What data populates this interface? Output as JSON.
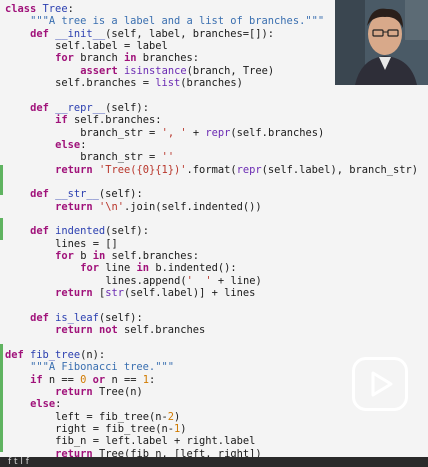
{
  "code_lines": [
    {
      "indent": 0,
      "tokens": [
        [
          "kw",
          "class "
        ],
        [
          "fn",
          "Tree"
        ],
        [
          "t",
          ":"
        ]
      ]
    },
    {
      "indent": 4,
      "tokens": [
        [
          "cm",
          "\"\"\"A tree is a label and a list of branches.\"\"\""
        ]
      ]
    },
    {
      "indent": 4,
      "tokens": [
        [
          "kw",
          "def "
        ],
        [
          "fn",
          "__init__"
        ],
        [
          "t",
          "(self, label, branches=[]):"
        ]
      ]
    },
    {
      "indent": 8,
      "tokens": [
        [
          "t",
          "self.label = label"
        ]
      ]
    },
    {
      "indent": 8,
      "tokens": [
        [
          "kw",
          "for "
        ],
        [
          "t",
          "branch "
        ],
        [
          "kw",
          "in "
        ],
        [
          "t",
          "branches:"
        ]
      ]
    },
    {
      "indent": 12,
      "tokens": [
        [
          "kw",
          "assert "
        ],
        [
          "bi",
          "isinstance"
        ],
        [
          "t",
          "(branch, Tree)"
        ]
      ]
    },
    {
      "indent": 8,
      "tokens": [
        [
          "t",
          "self.branches = "
        ],
        [
          "bi",
          "list"
        ],
        [
          "t",
          "(branches)"
        ]
      ]
    },
    {
      "indent": 0,
      "tokens": []
    },
    {
      "indent": 4,
      "tokens": [
        [
          "kw",
          "def "
        ],
        [
          "fn",
          "__repr__"
        ],
        [
          "t",
          "(self):"
        ]
      ]
    },
    {
      "indent": 8,
      "tokens": [
        [
          "kw",
          "if "
        ],
        [
          "t",
          "self.branches:"
        ]
      ]
    },
    {
      "indent": 12,
      "tokens": [
        [
          "t",
          "branch_str = "
        ],
        [
          "st",
          "', '"
        ],
        [
          "t",
          " + "
        ],
        [
          "bi",
          "repr"
        ],
        [
          "t",
          "(self.branches)"
        ]
      ]
    },
    {
      "indent": 8,
      "tokens": [
        [
          "kw",
          "else"
        ],
        [
          "t",
          ":"
        ]
      ]
    },
    {
      "indent": 12,
      "tokens": [
        [
          "t",
          "branch_str = "
        ],
        [
          "st",
          "''"
        ]
      ]
    },
    {
      "indent": 8,
      "tokens": [
        [
          "kw",
          "return "
        ],
        [
          "st",
          "'Tree({0}{1})'"
        ],
        [
          "t",
          ".format("
        ],
        [
          "bi",
          "repr"
        ],
        [
          "t",
          "(self.label), branch_str)"
        ]
      ]
    },
    {
      "indent": 0,
      "tokens": []
    },
    {
      "indent": 4,
      "tokens": [
        [
          "kw",
          "def "
        ],
        [
          "fn",
          "__str__"
        ],
        [
          "t",
          "(self):"
        ]
      ]
    },
    {
      "indent": 8,
      "tokens": [
        [
          "kw",
          "return "
        ],
        [
          "st",
          "'\\n'"
        ],
        [
          "t",
          ".join(self.indented())"
        ]
      ]
    },
    {
      "indent": 0,
      "tokens": []
    },
    {
      "indent": 4,
      "tokens": [
        [
          "kw",
          "def "
        ],
        [
          "fn",
          "indented"
        ],
        [
          "t",
          "(self):"
        ]
      ]
    },
    {
      "indent": 8,
      "tokens": [
        [
          "t",
          "lines = []"
        ]
      ]
    },
    {
      "indent": 8,
      "tokens": [
        [
          "kw",
          "for "
        ],
        [
          "t",
          "b "
        ],
        [
          "kw",
          "in "
        ],
        [
          "t",
          "self.branches:"
        ]
      ]
    },
    {
      "indent": 12,
      "tokens": [
        [
          "kw",
          "for "
        ],
        [
          "t",
          "line "
        ],
        [
          "kw",
          "in "
        ],
        [
          "t",
          "b.indented():"
        ]
      ]
    },
    {
      "indent": 16,
      "tokens": [
        [
          "t",
          "lines.append("
        ],
        [
          "st",
          "'  '"
        ],
        [
          "t",
          " + line)"
        ]
      ]
    },
    {
      "indent": 8,
      "tokens": [
        [
          "kw",
          "return "
        ],
        [
          "t",
          "["
        ],
        [
          "bi",
          "str"
        ],
        [
          "t",
          "(self.label)] + lines"
        ]
      ]
    },
    {
      "indent": 0,
      "tokens": []
    },
    {
      "indent": 4,
      "tokens": [
        [
          "kw",
          "def "
        ],
        [
          "fn",
          "is_leaf"
        ],
        [
          "t",
          "(self):"
        ]
      ]
    },
    {
      "indent": 8,
      "tokens": [
        [
          "kw",
          "return not "
        ],
        [
          "t",
          "self.branches"
        ]
      ]
    },
    {
      "indent": 0,
      "tokens": []
    },
    {
      "indent": 0,
      "tokens": [
        [
          "kw",
          "def "
        ],
        [
          "fn",
          "fib_tree"
        ],
        [
          "t",
          "(n):"
        ]
      ]
    },
    {
      "indent": 4,
      "tokens": [
        [
          "cm",
          "\"\"\"A Fibonacci tree.\"\"\""
        ]
      ]
    },
    {
      "indent": 4,
      "tokens": [
        [
          "kw",
          "if "
        ],
        [
          "t",
          "n == "
        ],
        [
          "num",
          "0"
        ],
        [
          "kw",
          " or "
        ],
        [
          "t",
          "n == "
        ],
        [
          "num",
          "1"
        ],
        [
          "t",
          ":"
        ]
      ]
    },
    {
      "indent": 8,
      "tokens": [
        [
          "kw",
          "return "
        ],
        [
          "t",
          "Tree(n)"
        ]
      ]
    },
    {
      "indent": 4,
      "tokens": [
        [
          "kw",
          "else"
        ],
        [
          "t",
          ":"
        ]
      ]
    },
    {
      "indent": 8,
      "tokens": [
        [
          "t",
          "left = fib_tree(n-"
        ],
        [
          "num",
          "2"
        ],
        [
          "t",
          ")"
        ]
      ]
    },
    {
      "indent": 8,
      "tokens": [
        [
          "t",
          "right = fib_tree(n-"
        ],
        [
          "num",
          "1"
        ],
        [
          "t",
          ")"
        ]
      ]
    },
    {
      "indent": 8,
      "tokens": [
        [
          "t",
          "fib_n = left.label + right.label"
        ]
      ]
    },
    {
      "indent": 8,
      "tokens": [
        [
          "kw",
          "return "
        ],
        [
          "t",
          "Tree(fib_n, [left, right])"
        ]
      ]
    }
  ],
  "bottom_bar": {
    "text": "f t   l   f    "
  },
  "icons": {
    "play": "play-icon",
    "webcam": "webcam-presenter"
  },
  "colors": {
    "keyword": "#a0127a",
    "function": "#2b3fb0",
    "string": "#b8352a",
    "number": "#d07a00",
    "docstring": "#3a6fb0",
    "gutter": "#5fb360"
  }
}
